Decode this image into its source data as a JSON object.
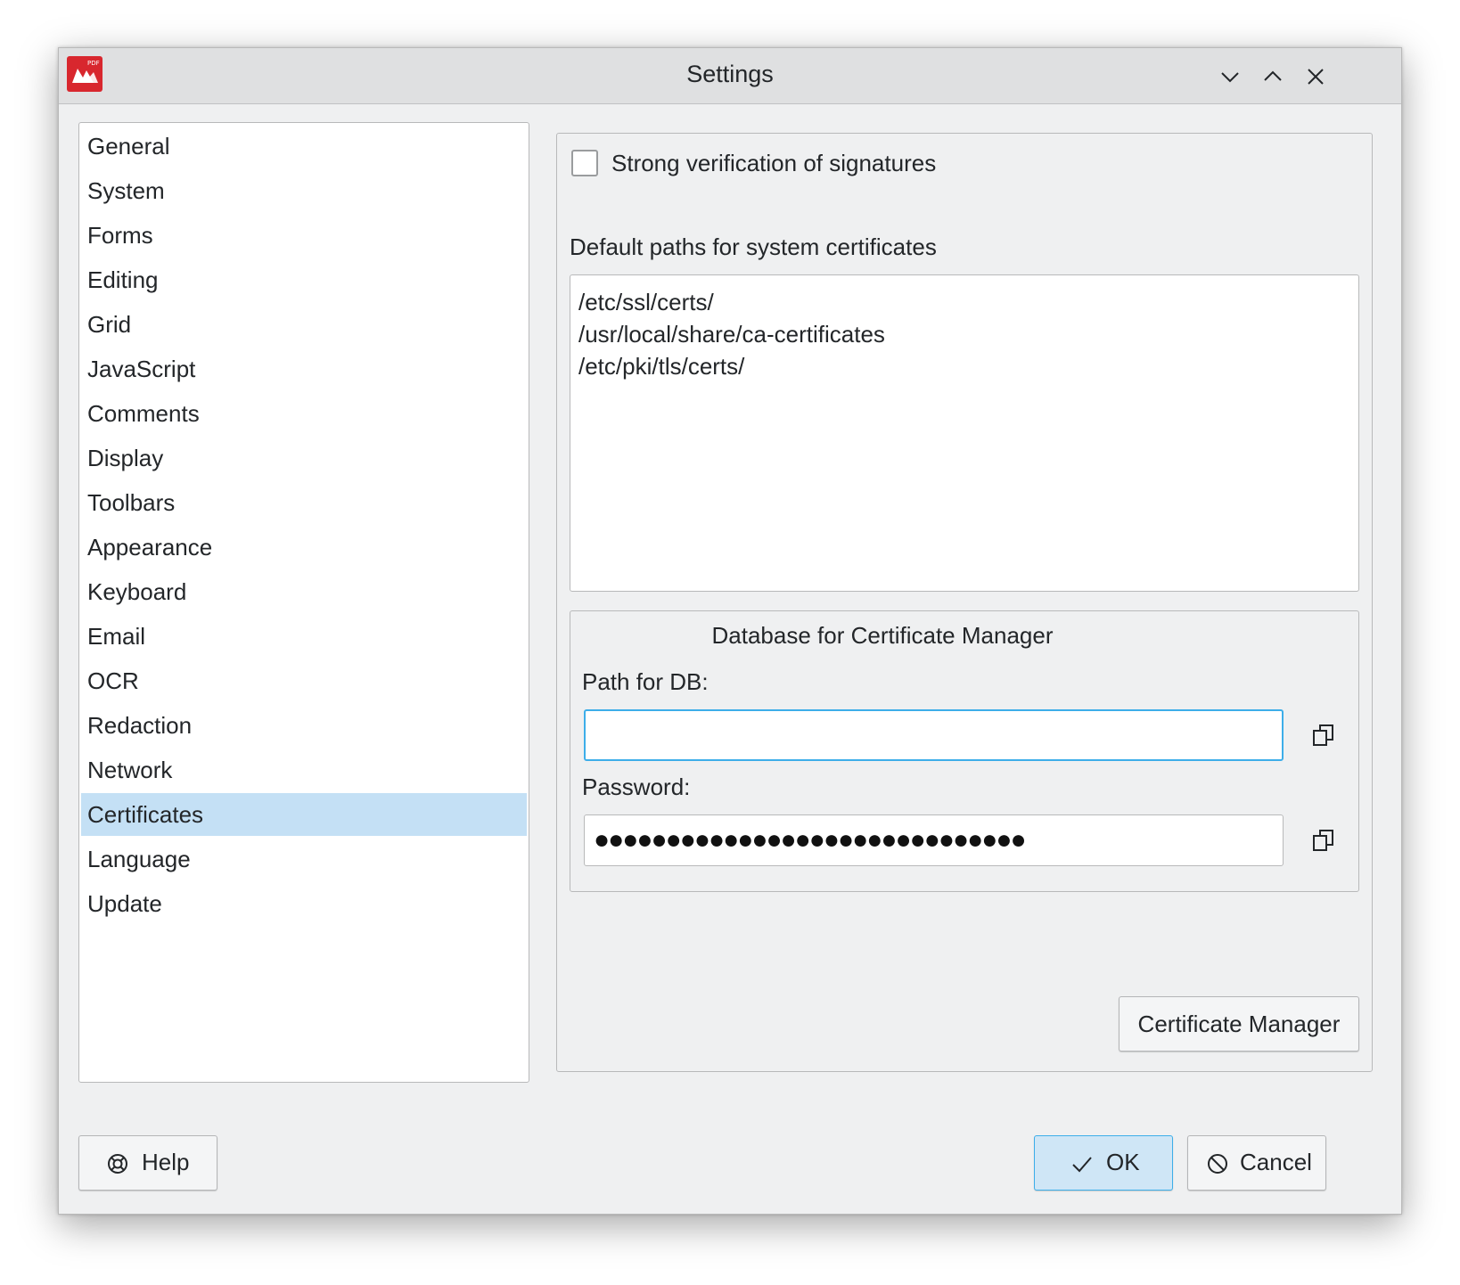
{
  "window": {
    "title": "Settings",
    "app_icon": "pdf-app-icon",
    "controls": [
      "minimize-icon",
      "maximize-icon",
      "close-icon"
    ]
  },
  "sidebar": {
    "selected": "Certificates",
    "items": [
      {
        "label": "General"
      },
      {
        "label": "System"
      },
      {
        "label": "Forms"
      },
      {
        "label": "Editing"
      },
      {
        "label": "Grid"
      },
      {
        "label": "JavaScript"
      },
      {
        "label": "Comments"
      },
      {
        "label": "Display"
      },
      {
        "label": "Toolbars"
      },
      {
        "label": "Appearance"
      },
      {
        "label": "Keyboard"
      },
      {
        "label": "Email"
      },
      {
        "label": "OCR"
      },
      {
        "label": "Redaction"
      },
      {
        "label": "Network"
      },
      {
        "label": "Certificates"
      },
      {
        "label": "Language"
      },
      {
        "label": "Update"
      }
    ]
  },
  "certificates": {
    "strong_verification_label": "Strong verification of signatures",
    "strong_verification_checked": false,
    "default_paths_label": "Default paths for system certificates",
    "default_paths": [
      "/etc/ssl/certs/",
      "/usr/local/share/ca-certificates",
      "/etc/pki/tls/certs/"
    ],
    "db_group_title": "Database for Certificate Manager",
    "path_label": "Path for DB:",
    "path_value": "",
    "password_label": "Password:",
    "password_value": "●●●●●●●●●●●●●●●●●●●●●●●●●●●●●●",
    "certificate_manager_button": "Certificate Manager"
  },
  "footer": {
    "help_label": "Help",
    "ok_label": "OK",
    "cancel_label": "Cancel"
  },
  "colors": {
    "selection": "#c4e0f5",
    "focus": "#3daee9",
    "brand": "#d8272e"
  }
}
